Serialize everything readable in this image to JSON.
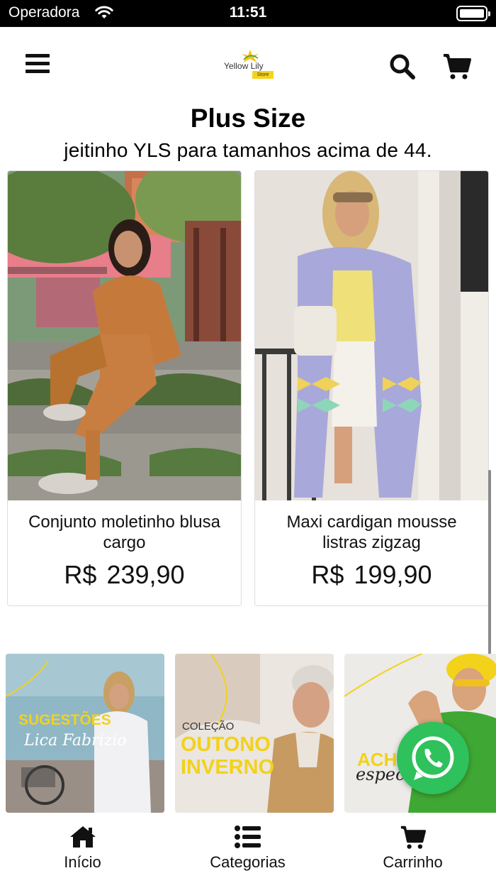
{
  "status_bar": {
    "carrier": "Operadora",
    "time": "11:51"
  },
  "header": {
    "logo_text": "Yellow Lily",
    "logo_tag": "Store",
    "icons": [
      "menu-icon",
      "search-icon",
      "cart-icon"
    ]
  },
  "section": {
    "title": "Plus Size",
    "subtitle": "jeitinho YLS para tamanhos acima de 44."
  },
  "products": [
    {
      "name": "Conjunto moletinho blusa cargo",
      "currency": "R$",
      "price": "239,90"
    },
    {
      "name": "Maxi cardigan mousse listras zigzag",
      "currency": "R$",
      "price": "199,90"
    }
  ],
  "banners": [
    {
      "line1": "SUGESTÕES",
      "line2": "Lica Fabrizio"
    },
    {
      "line1": "COLEÇÃO",
      "line2": "OUTONO",
      "line3": "INVERNO"
    },
    {
      "line1": "ACHADOS",
      "line2": "especiais"
    }
  ],
  "bottom_nav": {
    "items": [
      {
        "label": "Início",
        "icon": "home-icon"
      },
      {
        "label": "Categorias",
        "icon": "list-icon"
      },
      {
        "label": "Carrinho",
        "icon": "cart-icon"
      }
    ]
  },
  "colors": {
    "accent_yellow": "#f2d21a",
    "whatsapp_green": "#2fc15b"
  }
}
